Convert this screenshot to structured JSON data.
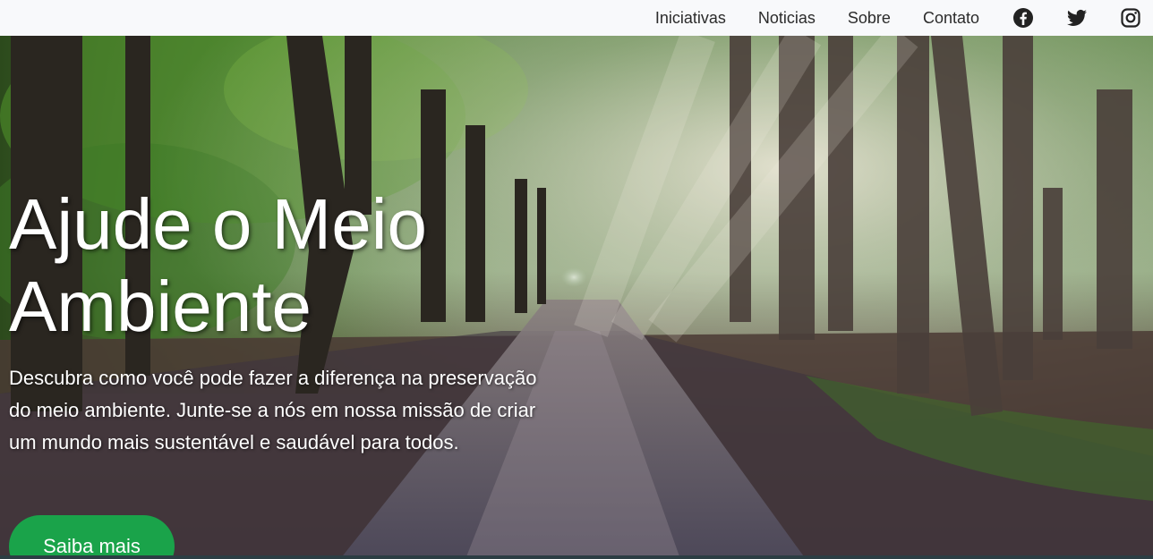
{
  "nav": {
    "links": [
      "Iniciativas",
      "Noticias",
      "Sobre",
      "Contato"
    ],
    "social_icons": [
      "facebook-icon",
      "twitter-icon",
      "instagram-icon"
    ]
  },
  "hero": {
    "title": "Ajude o Meio Ambiente",
    "text": "Descubra como você pode fazer a diferença na preservação do meio ambiente. Junte-se a nós em nossa missão de criar um mundo mais sustentável e saudável para todos.",
    "button_label": "Saiba mais"
  },
  "colors": {
    "button": "#1aa34a",
    "navbar": "#f8f9fb"
  }
}
